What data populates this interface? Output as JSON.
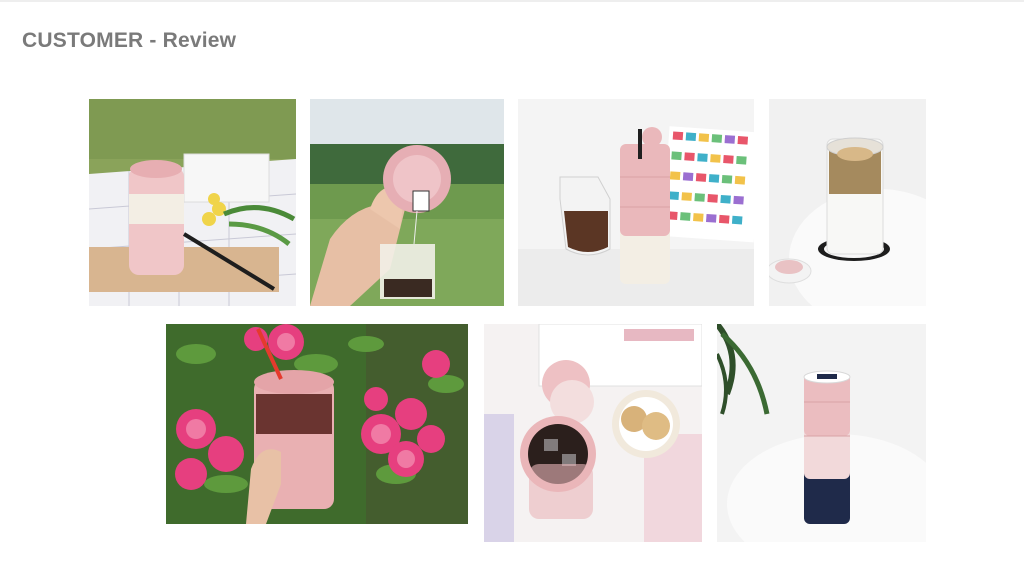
{
  "page": {
    "title": "CUSTOMER - Review"
  },
  "photos": [
    {
      "id": "review-photo-1",
      "alt": "Pink tumbler on picnic blanket with tulips"
    },
    {
      "id": "review-photo-2",
      "alt": "Hand holding tumbler lid with tea bag outdoors"
    },
    {
      "id": "review-photo-3",
      "alt": "Pink and cream tumbler beside iced coffee carafe"
    },
    {
      "id": "review-photo-4",
      "alt": "Clear tumbler with coffee on white table"
    },
    {
      "id": "review-photo-5",
      "alt": "Pink tumbler with straw held among pink roses"
    },
    {
      "id": "review-photo-6",
      "alt": "Open tumbler containers with ice and cookies"
    },
    {
      "id": "review-photo-7",
      "alt": "Pink and navy stacked tumbler beside plant"
    }
  ]
}
